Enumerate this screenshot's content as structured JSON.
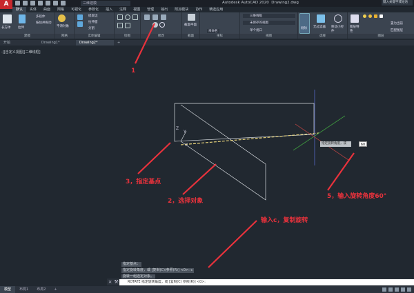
{
  "app": {
    "title": "Autodesk AutoCAD 2020",
    "file": "Drawing2.dwg",
    "logo": "A",
    "workspace": "三维建模",
    "search_placeholder": "键入关键字或短语"
  },
  "ribbon_tabs": [
    "默认",
    "实体",
    "曲面",
    "网格",
    "可视化",
    "参数化",
    "插入",
    "注释",
    "视图",
    "管理",
    "输出",
    "附加模块",
    "协作",
    "精选应用"
  ],
  "panels": {
    "modeling": "建模",
    "mesh": "网格",
    "solid_edit": "实体编辑",
    "draw": "绘图",
    "modify": "修改",
    "section": "截面",
    "coordinates": "坐标",
    "view": "视图",
    "selection": "选择",
    "layers": "图层"
  },
  "buttons": {
    "box": "长方体",
    "extrude": "拉伸",
    "polysolid": "多段体",
    "presspull": "按住并拖动",
    "smooth": "平滑对象",
    "extract_edges": "提取边",
    "extrude_face": "拉伸面",
    "separate": "分割",
    "section_plane": "截面平面",
    "visual_style": "三维线框",
    "saved_view": "未保存的视图",
    "unnamed": "未命名",
    "single_viewport": "单个视口",
    "culling": "剔除",
    "no_filter": "无过滤器",
    "move_gizmo": "移动小控件",
    "layer_props": "图层特性",
    "set_current": "置为当前",
    "match_layer": "匹配图层"
  },
  "doc_tabs": [
    "开始",
    "Drawing1*",
    "Drawing2*"
  ],
  "viewport_label": "-][自定义视图][二维线框]",
  "annotations": [
    "1",
    "3，指定基点",
    "2，选择对象",
    "5，输入旋转角度60°",
    "输入c，复制旋转"
  ],
  "dynamic_input": {
    "prompt": "指定旋转角度，或",
    "value": "60"
  },
  "command_history": [
    "指定基点：",
    "指定旋转角度，或 [复制(C)/参照(R)] <0>: c",
    "旋转一组选定对象。"
  ],
  "command_line": "ROTATE 指定旋转角度，或 [复制(C) 参照(R)] <0>:",
  "layout_tabs": [
    "模型",
    "布局1",
    "布局2"
  ],
  "colors": {
    "canvas": "#212830",
    "ribbon": "#3b4450",
    "annotation": "#e8323c",
    "logo": "#c8282d"
  }
}
